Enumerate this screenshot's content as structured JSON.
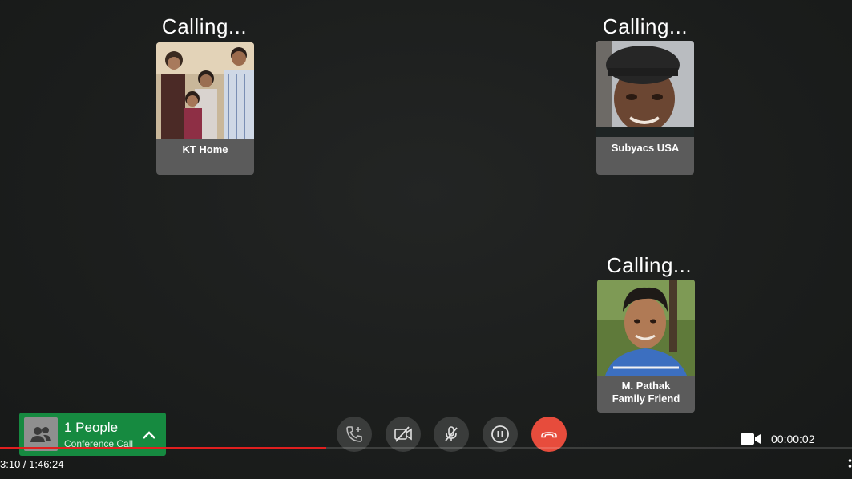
{
  "participants": [
    {
      "status": "Calling...",
      "name": "KT Home"
    },
    {
      "status": "Calling...",
      "name": "Subyacs USA"
    },
    {
      "status": "Calling...",
      "name_line1": "M. Pathak",
      "name_line2": "Family Friend"
    }
  ],
  "people_panel": {
    "count_label": "1 People",
    "sub_label": "Conference Call",
    "icon": "people-icon",
    "expand_icon": "chevron-up-icon",
    "color": "#168a40"
  },
  "controls": [
    {
      "name": "add-call-button",
      "icon": "phone-plus-icon"
    },
    {
      "name": "video-off-button",
      "icon": "video-off-icon"
    },
    {
      "name": "mute-button",
      "icon": "mic-off-icon"
    },
    {
      "name": "hold-button",
      "icon": "pause-icon"
    },
    {
      "name": "end-call-button",
      "icon": "hangup-icon",
      "color": "#e74c3c"
    }
  ],
  "call_duration": "00:00:02",
  "player": {
    "time_display": "3:10 / 1:46:24",
    "progress": 0.383,
    "progress_color": "#e01f1f"
  }
}
